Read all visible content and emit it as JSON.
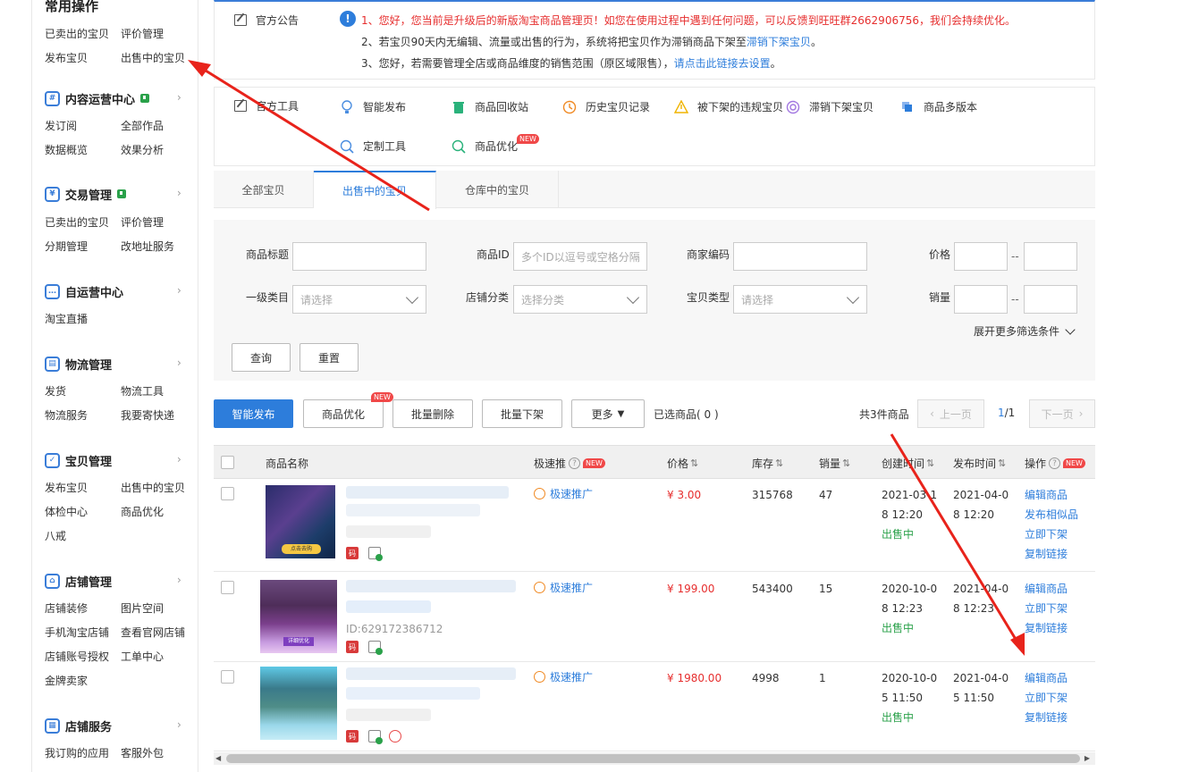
{
  "sidebar": {
    "title": "常用操作",
    "quick": [
      "已卖出的宝贝",
      "评价管理",
      "发布宝贝",
      "出售中的宝贝"
    ],
    "sections": [
      {
        "title": "内容运营中心",
        "icon": "#",
        "items": [
          "发订阅",
          "全部作品",
          "数据概览",
          "效果分析"
        ]
      },
      {
        "title": "交易管理",
        "icon": "¥",
        "items": [
          "已卖出的宝贝",
          "评价管理",
          "分期管理",
          "改地址服务"
        ]
      },
      {
        "title": "自运营中心",
        "icon": "…",
        "items": [
          "淘宝直播"
        ]
      },
      {
        "title": "物流管理",
        "icon": "▤",
        "items": [
          "发货",
          "物流工具",
          "物流服务",
          "我要寄快递"
        ]
      },
      {
        "title": "宝贝管理",
        "icon": "✓",
        "items": [
          "发布宝贝",
          "出售中的宝贝",
          "体检中心",
          "商品优化",
          "八戒"
        ]
      },
      {
        "title": "店铺管理",
        "icon": "⌂",
        "items": [
          "店铺装修",
          "图片空间",
          "手机淘宝店铺",
          "查看官网店铺",
          "店铺账号授权",
          "工单中心",
          "金牌卖家"
        ]
      },
      {
        "title": "店铺服务",
        "icon": "▦",
        "items": [
          "我订购的应用",
          "客服外包"
        ]
      }
    ]
  },
  "notice": {
    "label": "官方公告",
    "line1": "1、您好，您当前是升级后的新版淘宝商品管理页！如您在使用过程中遇到任何问题，可以反馈到旺旺群2662906756，我们会持续优化。",
    "line2_text": "2、若宝贝90天内无编辑、流量或出售的行为，系统将把宝贝作为滞销商品下架至",
    "line2_link": "滞销下架宝贝",
    "line2_end": "。",
    "line3_text": "3、您好，若需要管理全店或商品维度的销售范围（原区域限售），",
    "line3_link": "请点击此链接去设置",
    "line3_end": "。"
  },
  "tools": {
    "label": "官方工具",
    "items": [
      "智能发布",
      "商品回收站",
      "历史宝贝记录",
      "被下架的违规宝贝",
      "滞销下架宝贝",
      "商品多版本",
      "定制工具",
      "商品优化"
    ],
    "new_tag": "NEW"
  },
  "tabs": [
    "全部宝贝",
    "出售中的宝贝",
    "仓库中的宝贝"
  ],
  "filters": {
    "title_label": "商品标题",
    "id_label": "商品ID",
    "id_placeholder": "多个ID以逗号或空格分隔",
    "code_label": "商家编码",
    "price_label": "价格",
    "cat1_label": "一级类目",
    "cat1_placeholder": "请选择",
    "shopcat_label": "店铺分类",
    "shopcat_placeholder": "选择分类",
    "type_label": "宝贝类型",
    "type_placeholder": "请选择",
    "sales_label": "销量",
    "range_sep": "--",
    "query_button": "查询",
    "reset_button": "重置",
    "expand_label": "展开更多筛选条件"
  },
  "actions": {
    "smart_publish": "智能发布",
    "optimize": "商品优化",
    "batch_delete": "批量删除",
    "batch_unlist": "批量下架",
    "more": "更多",
    "selected": "已选商品( 0 )",
    "total": "共3件商品",
    "prev": "上一页",
    "next": "下一页",
    "page": "1",
    "page_total": "/1"
  },
  "table": {
    "headers": {
      "name": "商品名称",
      "promo": "极速推",
      "price": "价格",
      "stock": "库存",
      "sales": "销量",
      "created": "创建时间",
      "published": "发布时间",
      "ops": "操作"
    },
    "rows": [
      {
        "promo": "极速推广",
        "price": "¥ 3.00",
        "stock": "315768",
        "sales": "47",
        "created1": "2021-03-1",
        "created2": "8 12:20",
        "status": "出售中",
        "pub1": "2021-04-0",
        "pub2": "8 12:20",
        "ops": [
          "编辑商品",
          "发布相似品",
          "立即下架",
          "复制链接"
        ],
        "thumb_text": "点击去购",
        "id_text": ""
      },
      {
        "promo": "极速推广",
        "price": "¥ 199.00",
        "stock": "543400",
        "sales": "15",
        "created1": "2020-10-0",
        "created2": "8 12:23",
        "status": "出售中",
        "pub1": "2021-04-0",
        "pub2": "8 12:23",
        "ops": [
          "编辑商品",
          "立即下架",
          "复制链接"
        ],
        "thumb_text": "详细优化",
        "id_text": "ID:629172386712"
      },
      {
        "promo": "极速推广",
        "price": "¥ 1980.00",
        "stock": "4998",
        "sales": "1",
        "created1": "2020-10-0",
        "created2": "5 11:50",
        "status": "出售中",
        "pub1": "2021-04-0",
        "pub2": "5 11:50",
        "ops": [
          "编辑商品",
          "立即下架",
          "复制链接"
        ],
        "thumb_text": "",
        "id_text": ""
      }
    ],
    "code_badge": "码"
  }
}
